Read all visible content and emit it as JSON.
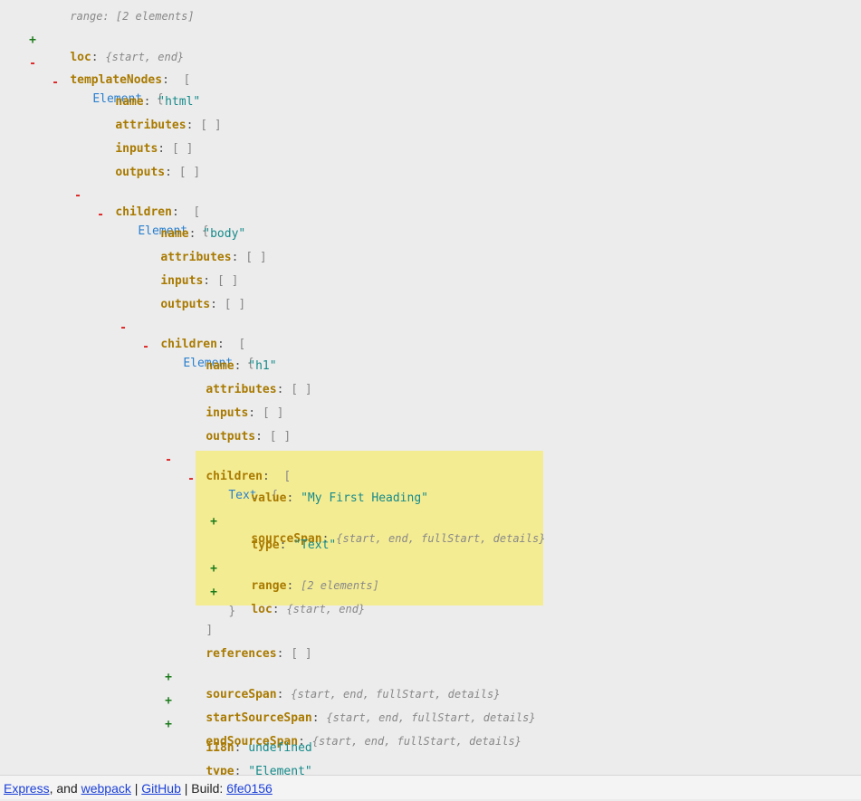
{
  "tree": {
    "top_partial": "range: [2 elements]",
    "loc_key": "loc",
    "loc_preview": "{start, end}",
    "templateNodes_key": "templateNodes",
    "html_element": {
      "type_label": "Element",
      "name_key": "name",
      "name_value": "\"html\"",
      "attributes_key": "attributes",
      "inputs_key": "inputs",
      "outputs_key": "outputs",
      "children_key": "children"
    },
    "body_element": {
      "type_label": "Element",
      "name_key": "name",
      "name_value": "\"body\"",
      "attributes_key": "attributes",
      "inputs_key": "inputs",
      "outputs_key": "outputs",
      "children_key": "children"
    },
    "h1_element": {
      "type_label": "Element",
      "name_key": "name",
      "name_value": "\"h1\"",
      "attributes_key": "attributes",
      "inputs_key": "inputs",
      "outputs_key": "outputs",
      "children_key": "children",
      "references_key": "references",
      "sourceSpan_key": "sourceSpan",
      "sourceSpan_preview": "{start, end, fullStart, details}",
      "startSourceSpan_key": "startSourceSpan",
      "startSourceSpan_preview": "{start, end, fullStart, details}",
      "endSourceSpan_key": "endSourceSpan",
      "endSourceSpan_preview": "{start, end, fullStart, details}",
      "i18n_key": "i18n",
      "i18n_value": "undefined",
      "type_key": "type",
      "type_value": "\"Element\""
    },
    "text_node": {
      "type_label": "Text",
      "value_key": "value",
      "value_value": "\"My First Heading\"",
      "sourceSpan_key": "sourceSpan",
      "sourceSpan_preview": "{start, end, fullStart, details}",
      "type_key": "type",
      "type_value": "\"Text\"",
      "range_key": "range",
      "range_preview": "[2 elements]",
      "loc_key": "loc",
      "loc_preview": "{start, end}"
    },
    "empty_array": "[ ]",
    "open_bracket": "[",
    "close_bracket": "]",
    "open_brace": "{",
    "close_brace": "}",
    "colon": ":",
    "minus": "-",
    "plus": "+"
  },
  "footer": {
    "express_link": "Express",
    "and_text": ", and ",
    "webpack_link": "webpack",
    "sep1": " | ",
    "github_link": "GitHub",
    "build_label": " | Build: ",
    "build_hash": "6fe0156"
  }
}
